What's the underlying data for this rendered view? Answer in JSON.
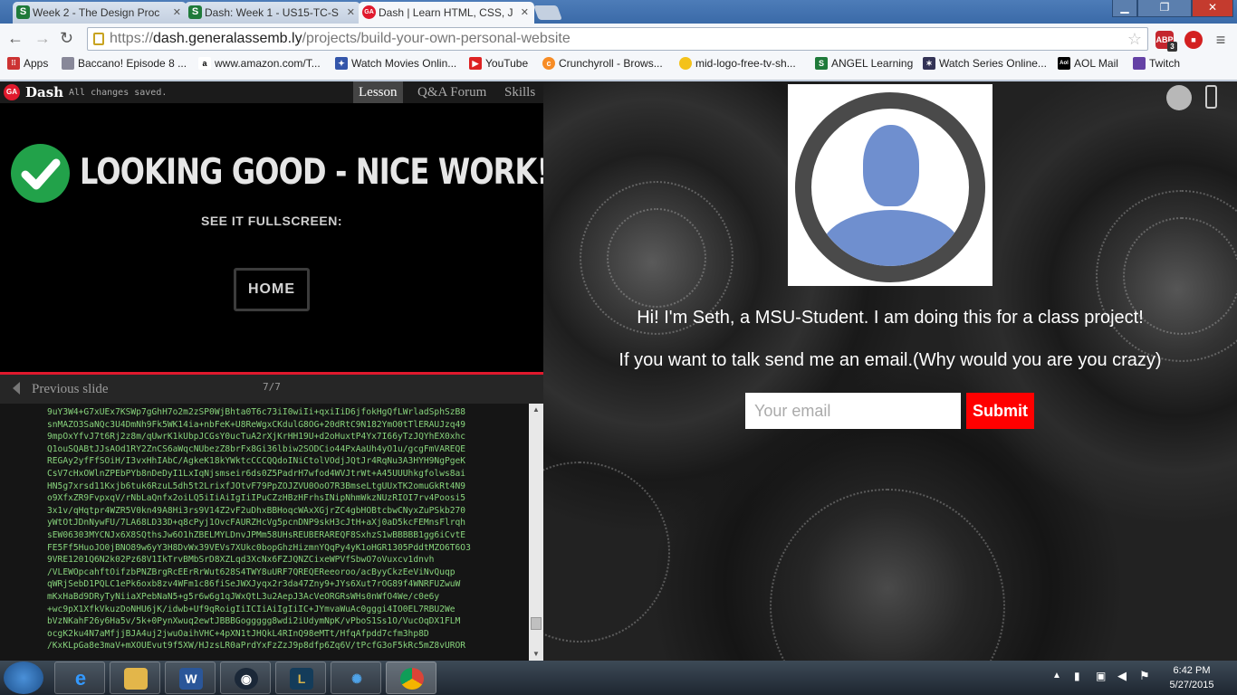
{
  "browser": {
    "tabs": [
      {
        "label": "Week 2 - The Design Proc",
        "icon": "S",
        "color": "#1f7a3a",
        "active": false
      },
      {
        "label": "Dash: Week 1 - US15-TC-S",
        "icon": "S",
        "color": "#1f7a3a",
        "active": false
      },
      {
        "label": "Dash | Learn HTML, CSS, J",
        "icon": "GA",
        "color": "#e0192d",
        "active": true
      }
    ],
    "url_prefix": "https://",
    "url_host": "dash.generalassemb.ly",
    "url_path": "/projects/build-your-own-personal-website",
    "window_controls": {
      "minimize": "▁",
      "maximize": "❐",
      "close": "✕"
    },
    "extensions": [
      {
        "name": "ABP",
        "badge": "3"
      },
      {
        "name": "stop-icon"
      }
    ],
    "bookmarks": [
      {
        "label": "Apps",
        "icon": "apps-icon"
      },
      {
        "label": "Baccano! Episode 8 ...",
        "icon": "page-icon"
      },
      {
        "label": "www.amazon.com/T...",
        "icon": "amazon-icon"
      },
      {
        "label": "Watch Movies Onlin...",
        "icon": "movie-icon"
      },
      {
        "label": "YouTube",
        "icon": "youtube-icon"
      },
      {
        "label": "Crunchyroll - Brows...",
        "icon": "crunchyroll-icon"
      },
      {
        "label": "mid-logo-free-tv-sh...",
        "icon": "tv-icon"
      },
      {
        "label": "ANGEL Learning",
        "icon": "angel-icon"
      },
      {
        "label": "Watch Series Online...",
        "icon": "series-icon"
      },
      {
        "label": "AOL Mail",
        "icon": "aol-icon"
      },
      {
        "label": "Twitch",
        "icon": "twitch-icon"
      }
    ]
  },
  "dash": {
    "brand": "Dash",
    "logo": "GA",
    "status": "All changes saved.",
    "tabs": [
      "Lesson",
      "Q&A Forum",
      "Skills"
    ],
    "heading": "LOOKING GOOD - NICE WORK!",
    "subheading": "SEE IT FULLSCREEN:",
    "home_button": "HOME",
    "prev_slide": "Previous slide",
    "slide_counter": "7/7",
    "code": "9uY3W4+G7xUEx7KSWp7gGhH7o2m2zSP0WjBhta0T6c73iI0wiIi+qxiIiD6jfokHgQfLWrladSphSzB8\nsnMAZO3SaNQc3U4DmNh9Fk5WK14ia+nbFeK+U8ReWgxCKdulG8OG+20dRtC9N182YmO0tTlERAUJzq49\n9mpOxYfvJ7t6Rj2z8m/qUwrK1kUbpJCGsY0ucTuA2rXjKrHH19U+d2oHuxtP4Yx7I66yTzJQYhEX0xhc\nQ1ouSQABtJJsAOd1RY2ZnCS6aWqcNUbezZ8brFx8Gi36lbiw2SODCio44PxAaUh4yO1u/gcgFmVAREQE\nREGAy2yfFfSOiH/I3vxHhIAbC/AgkeK18kYWktcCCCQQdoINiCtolVOdjJQtJr4RqNu3A3HYH9NgPgeK\nCsV7cHxOWlnZPEbPYb8nDeDyI1LxIqNjsmseir6ds0Z5PadrH7wfod4WVJtrWt+A45UUUhkgfolws8ai\nHN5g7xrsd11Kxjb6tuk6RzuL5dh5t2LrixfJOtvF79PpZOJZVU0OoO7R3BmseLtgUUxTK2omuGkRt4N9\no9XfxZR9FvpxqV/rNbLaQnfx2oiLQ5iIiAiIgIiIPuCZzHBzHFrhsINipNhmWkzNUzRIOI7rv4Poosi5\n3x1v/qHqtpr4WZR5V0kn49A8Hi3rs9V14Z2vF2uDhxBBHoqcWAxXGjrZC4gbHOBtcbwCNyxZuPSkb270\nyWtOtJDnNywFU/7LA68LD33D+q8cPyj1OvcFAURZHcVg5pcnDNP9skH3cJtH+aXj0aD5kcFEMnsFlrqh\nsEW06303MYCNJx6X8SQthsJw6O1hZBELMYLDnvJPMm58UHsREUBERAREQF8SxhzS1wBBBBB1gg6iCvtE\nFE5Ff5HuoJO0jBNO89w6yY3H8DvWx39VEVs7XUkc0bopGhzHizmnYQqPy4yK1oHGR1305PddtMZO6T6O3\n9VRE1201Q6N2k02Pz68V1IkTrvBMbSrD8XZLqd3XcNx6FZJQNZCixeWPVfSbwO7oVuxcv1dnvh\n/VLEWOpcahftOifzbPNZBrgRcEErRrWut628S4TWY8uURF7QREQEReeoroo/acByyCkzEeViNvQuqp\nqWRjSebD1PQLC1ePk6oxb8zv4WFm1c86fiSeJWXJyqx2r3da47Zny9+JYs6Xut7rOG89f4WNRFUZwuW\nmKxHaBd9DRyTyNiiaXPebNaN5+g5r6w6g1qJWxQtL3u2AepJ3AcVeORGRsWHs0nWfO4We/c0e6y\n+wc9pX1XfkVkuzDoNHU6jK/idwb+Uf9qRoigIiICIiAiIgIiIC+JYmvaWuAc0gggi4IO0EL7RBU2We\nbVzNKahF26y6Ha5v/5k+0PynXwuq2ewtJBBBGoggggg8wdi2iUdymNpK/vPboS1Ss1O/VucOqDX1FLM\nocgK2ku4N7aMfjjBJA4uj2jwuOaihVHC+4pXN1tJHQkL4RInQ98eMTt/HfqAfpdd7cfm3hp8D\n/KxKLpGa8e3maV+mXOUEvut9f5XW/HJzsLR0aPrdYxFzZzJ9p8dfp6Zq6V/tPcfG3oF5kRc5mZ8vUROR"
  },
  "profile": {
    "greeting": "Hi! I'm Seth, a MSU-Student. I am doing this for a class project!",
    "contact_line": "If you want to talk send me an email.(Why would you are you crazy)",
    "email_placeholder": "Your email",
    "submit_label": "Submit"
  },
  "taskbar": {
    "apps": [
      "ie-icon",
      "explorer-icon",
      "word-icon",
      "steam-icon",
      "league-icon",
      "battlenet-icon",
      "chrome-icon"
    ],
    "time": "6:42 PM",
    "date": "5/27/2015"
  }
}
